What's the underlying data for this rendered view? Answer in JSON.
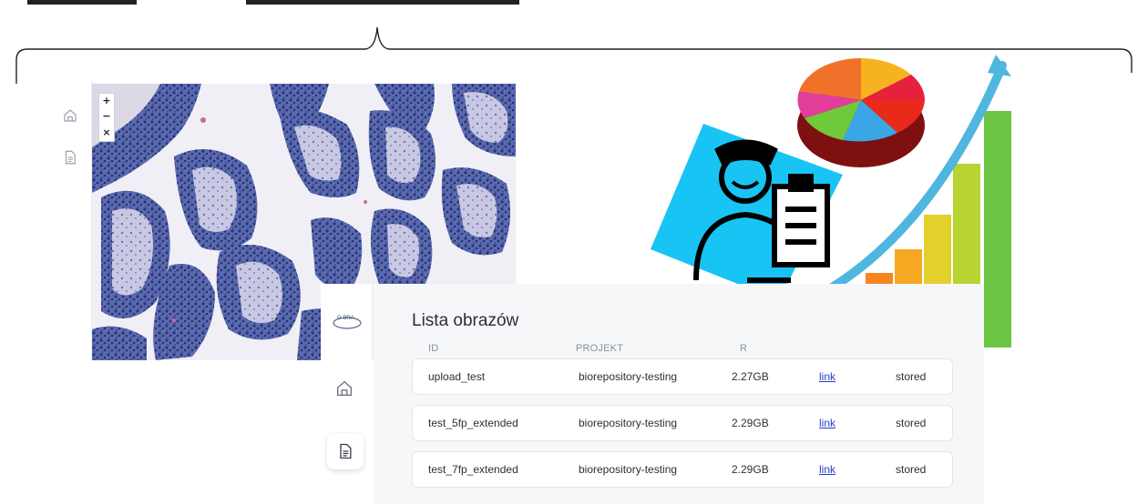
{
  "viewer": {
    "zoom_in": "+",
    "zoom_out": "−",
    "zoom_close": "×"
  },
  "app": {
    "logo_text": "G BRA"
  },
  "list": {
    "title": "Lista obrazów",
    "columns": [
      "ID",
      "PROJEKT",
      "R"
    ],
    "rows": [
      {
        "id": "upload_test",
        "project": "biorepository-testing",
        "size": "2.27GB",
        "link": "link",
        "status": "stored"
      },
      {
        "id": "test_5fp_extended",
        "project": "biorepository-testing",
        "size": "2.29GB",
        "link": "link",
        "status": "stored"
      },
      {
        "id": "test_7fp_extended",
        "project": "biorepository-testing",
        "size": "2.29GB",
        "link": "link",
        "status": "stored"
      }
    ]
  },
  "colors": {
    "accent_link": "#2a3cc0",
    "panel_bg": "#f6f7f9",
    "tissue_stain": "#3c4f9c",
    "card_blue": "#15c2f2"
  },
  "icons": [
    "home-icon",
    "document-icon",
    "pie-chart-icon",
    "growth-arrow-icon",
    "doctor-clipboard-icon"
  ]
}
